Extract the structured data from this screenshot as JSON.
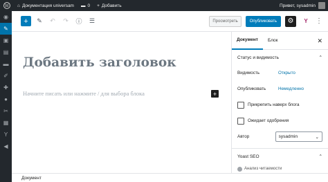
{
  "adminbar": {
    "site_name": "Документация universam",
    "comments_count": "0",
    "new_label": "Добавить",
    "greeting": "Привет, sysadmin"
  },
  "toolbar": {
    "preview_label": "Просмотреть",
    "publish_label": "Опубликовать"
  },
  "editor": {
    "title_placeholder": "Добавить заголовок",
    "block_placeholder": "Начните писать или нажмите / для выбора блока"
  },
  "settings": {
    "tabs": [
      "Документ",
      "Блок"
    ],
    "status_section": "Статус и видимость",
    "visibility_label": "Видимость",
    "visibility_value": "Открыто",
    "publish_label": "Опубликовать",
    "publish_value": "Немедленно",
    "stick_label": "Прикрепить наверх блога",
    "pending_label": "Ожидает одобрения",
    "author_label": "Автор",
    "author_value": "sysadmin",
    "yoast_section": "Yoast SEO",
    "readability_label": "Анализ читаемости"
  },
  "footer": {
    "breadcrumb": "Документ"
  },
  "colors": {
    "accent": "#007cba",
    "adminbar": "#23282d",
    "yoast": "#a4286a"
  }
}
